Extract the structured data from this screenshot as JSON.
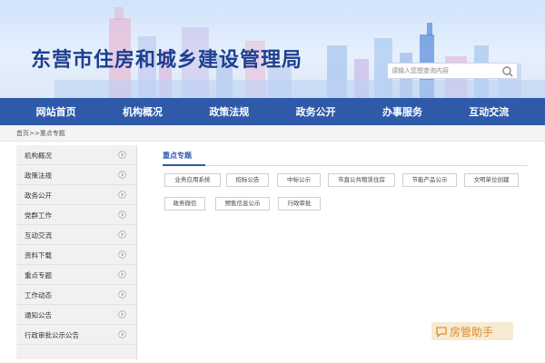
{
  "header": {
    "site_title": "东营市住房和城乡建设管理局",
    "search_placeholder": "请输入您想查询内容"
  },
  "nav": {
    "items": [
      {
        "label": "网站首页"
      },
      {
        "label": "机构概况"
      },
      {
        "label": "政策法规"
      },
      {
        "label": "政务公开"
      },
      {
        "label": "办事服务"
      },
      {
        "label": "互动交流"
      }
    ]
  },
  "breadcrumb": "首页>>重点专题",
  "sidebar": {
    "items": [
      {
        "label": "机构概况"
      },
      {
        "label": "政策法规"
      },
      {
        "label": "政务公开"
      },
      {
        "label": "党群工作"
      },
      {
        "label": "互动交流"
      },
      {
        "label": "资料下载"
      },
      {
        "label": "重点专题"
      },
      {
        "label": "工作动态"
      },
      {
        "label": "通知公告"
      },
      {
        "label": "行政审批公示公告"
      }
    ]
  },
  "main": {
    "section_title": "重点专题",
    "tags": [
      {
        "label": "业务应用系统"
      },
      {
        "label": "招标公告"
      },
      {
        "label": "中标公示"
      },
      {
        "label": "市直公共租赁住房"
      },
      {
        "label": "节能产品公示"
      },
      {
        "label": "文明单位创建"
      },
      {
        "label": "政务微信"
      },
      {
        "label": "预售信息公示"
      },
      {
        "label": "行政审批"
      }
    ]
  },
  "watermark": {
    "text": "房管助手"
  },
  "colors": {
    "nav_bg": "#2e5aa9",
    "title": "#1d3f8f",
    "watermark_text": "#e38a2a"
  }
}
